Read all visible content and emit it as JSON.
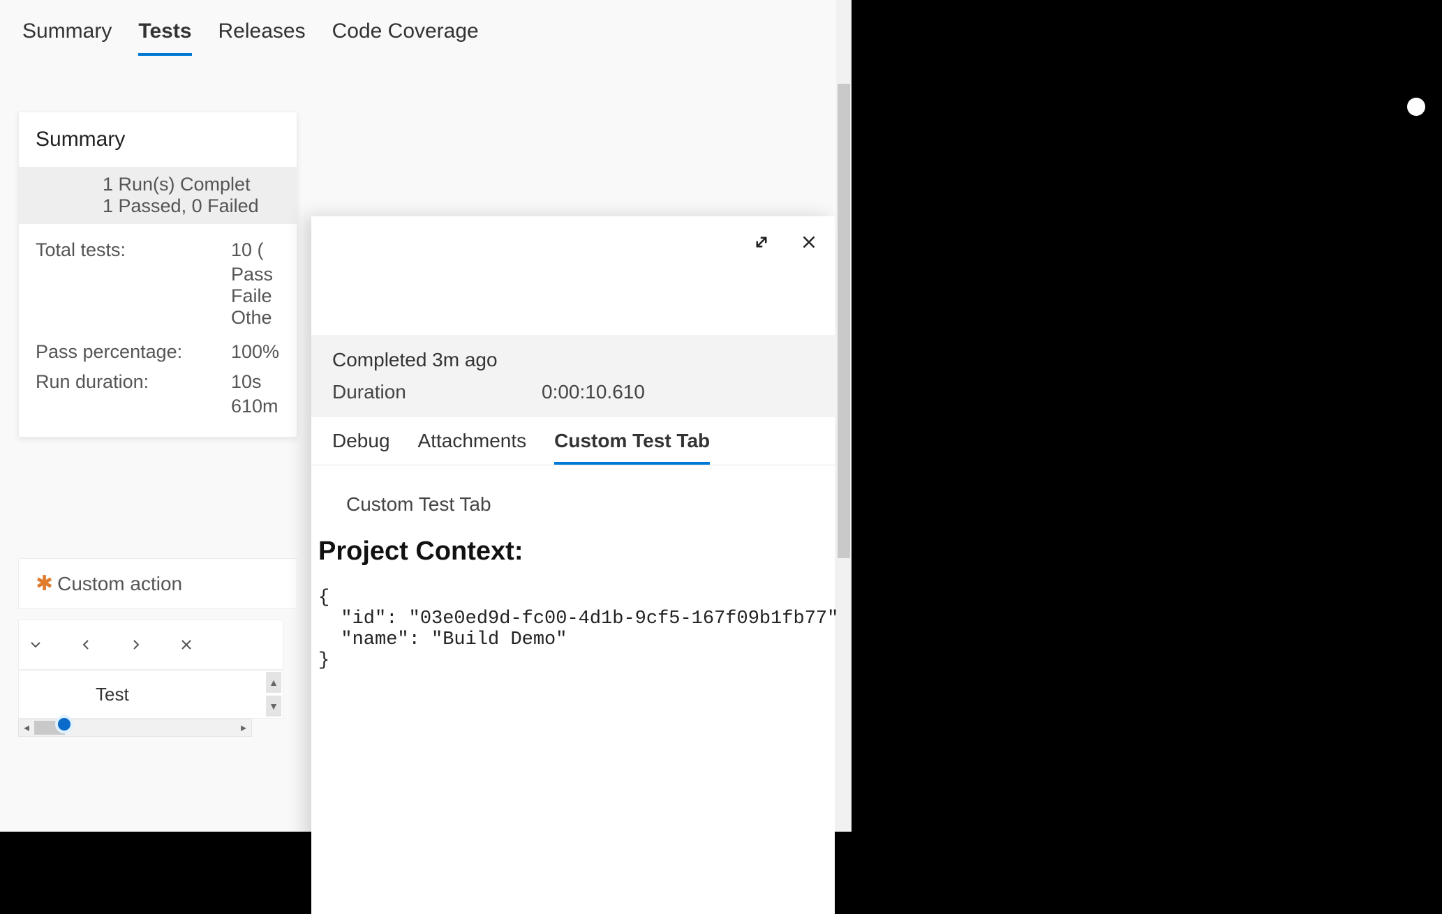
{
  "topTabs": {
    "summary": "Summary",
    "tests": "Tests",
    "releases": "Releases",
    "codeCoverage": "Code Coverage",
    "active": "tests"
  },
  "summaryCard": {
    "heading": "Summary",
    "runsLine1": "1 Run(s) Complet",
    "runsLine2": "1 Passed, 0 Failed",
    "totalLabel": "Total tests:",
    "totalValue": "10 (",
    "passSub": "Pass",
    "failSub": "Faile",
    "otherSub": "Othe",
    "passPctLabel": "Pass percentage:",
    "passPctValue": "100%",
    "runDurLabel": "Run duration:",
    "runDurValue": "10s",
    "runDurSub": "610m"
  },
  "customAction": {
    "label": "Custom action"
  },
  "gridHeader": {
    "testCol": "Test"
  },
  "detail": {
    "completed": "Completed 3m ago",
    "durationLabel": "Duration",
    "durationValue": "0:00:10.610",
    "tabs": {
      "debug": "Debug",
      "attachments": "Attachments",
      "custom": "Custom Test Tab",
      "active": "custom"
    },
    "body": {
      "tabTitle": "Custom Test Tab",
      "sectionTitle": "Project Context:",
      "code": "{\n  \"id\": \"03e0ed9d-fc00-4d1b-9cf5-167f09b1fb77\",\n  \"name\": \"Build Demo\"\n}"
    }
  }
}
